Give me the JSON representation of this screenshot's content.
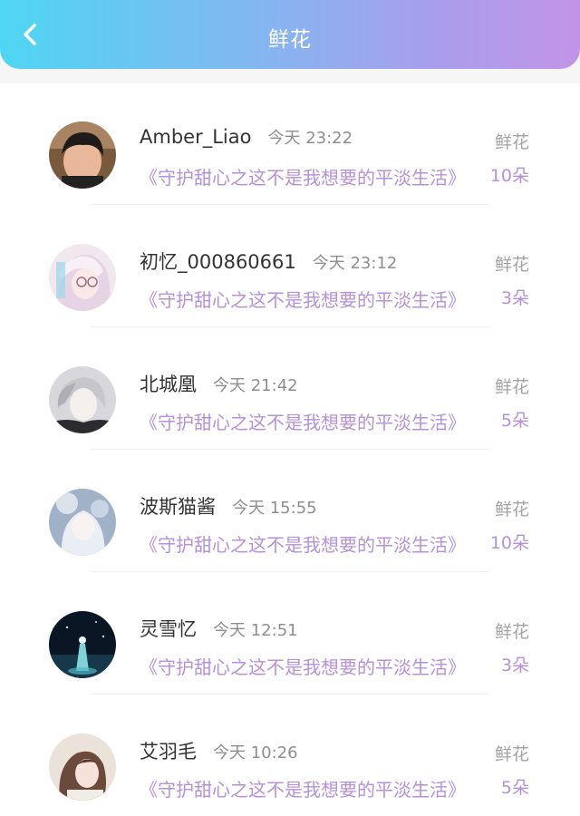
{
  "header": {
    "title": "鲜花",
    "back_icon": "chevron-left-icon",
    "gradient": [
      "#4fd6f3",
      "#c294e8"
    ]
  },
  "items": [
    {
      "username": "Amber_Liao",
      "time": "今天 23:22",
      "book": "《守护甜心之这不是我想要的平淡生活》",
      "gift_label": "鲜花",
      "count": "10朵"
    },
    {
      "username": "初忆_000860661",
      "time": "今天 23:12",
      "book": "《守护甜心之这不是我想要的平淡生活》",
      "gift_label": "鲜花",
      "count": "3朵"
    },
    {
      "username": "北城凰",
      "time": "今天 21:42",
      "book": "《守护甜心之这不是我想要的平淡生活》",
      "gift_label": "鲜花",
      "count": "5朵"
    },
    {
      "username": "波斯猫酱",
      "time": "今天 15:55",
      "book": "《守护甜心之这不是我想要的平淡生活》",
      "gift_label": "鲜花",
      "count": "10朵"
    },
    {
      "username": "灵雪忆",
      "time": "今天 12:51",
      "book": "《守护甜心之这不是我想要的平淡生活》",
      "gift_label": "鲜花",
      "count": "3朵"
    },
    {
      "username": "艾羽毛",
      "time": "今天 10:26",
      "book": "《守护甜心之这不是我想要的平淡生活》",
      "gift_label": "鲜花",
      "count": "5朵"
    }
  ],
  "colors": {
    "accent_purple": "#b491d9",
    "muted_gray": "#8e8e8e"
  }
}
